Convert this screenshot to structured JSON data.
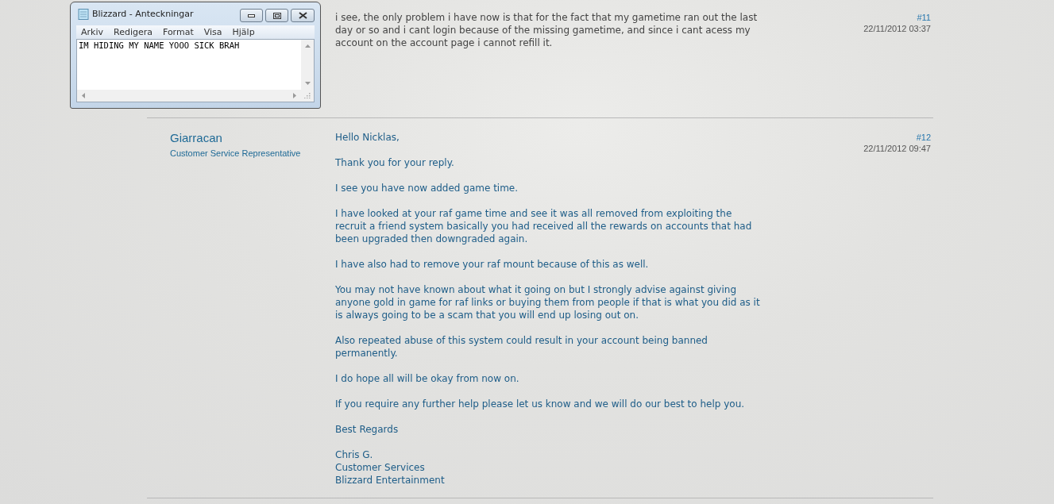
{
  "notepad": {
    "title": "Blizzard - Anteckningar",
    "menu": [
      "Arkiv",
      "Redigera",
      "Format",
      "Visa",
      "Hjälp"
    ],
    "content": "IM HIDING MY NAME YOOO SICK BRAH"
  },
  "posts": [
    {
      "number": "#11",
      "date": "22/11/2012 03:37",
      "kind": "player",
      "paragraphs": [
        "i see, the only problem i have now is that for the fact that my gametime ran out the last day or so and i cant login because of the missing gametime, and since i cant acess my account on the account page i cannot refill it."
      ]
    },
    {
      "author": "Giarracan",
      "role": "Customer Service Representative",
      "number": "#12",
      "date": "22/11/2012 09:47",
      "kind": "staff",
      "paragraphs": [
        "Hello Nicklas,",
        "Thank you for your reply.",
        "I see you have now added game time.",
        "I have looked at your raf game time and see it was all removed from exploiting the recruit a friend system basically you had received all the rewards on accounts that had been upgraded then downgraded again.",
        "I have also had to remove your raf mount because of this as well.",
        "You may not have known about what it going on but I strongly advise against giving anyone gold in game for raf links or buying them from people if that is what you did as it is always going to be a scam that you will end up losing out on.",
        "Also repeated abuse of this system could result in your account being banned permanently.",
        "I do hope all will be okay from now on.",
        "If you require any further help please let us know and we will do our best to help you.",
        "Best Regards",
        "Chris G.\nCustomer Services\nBlizzard Entertainment"
      ]
    }
  ]
}
